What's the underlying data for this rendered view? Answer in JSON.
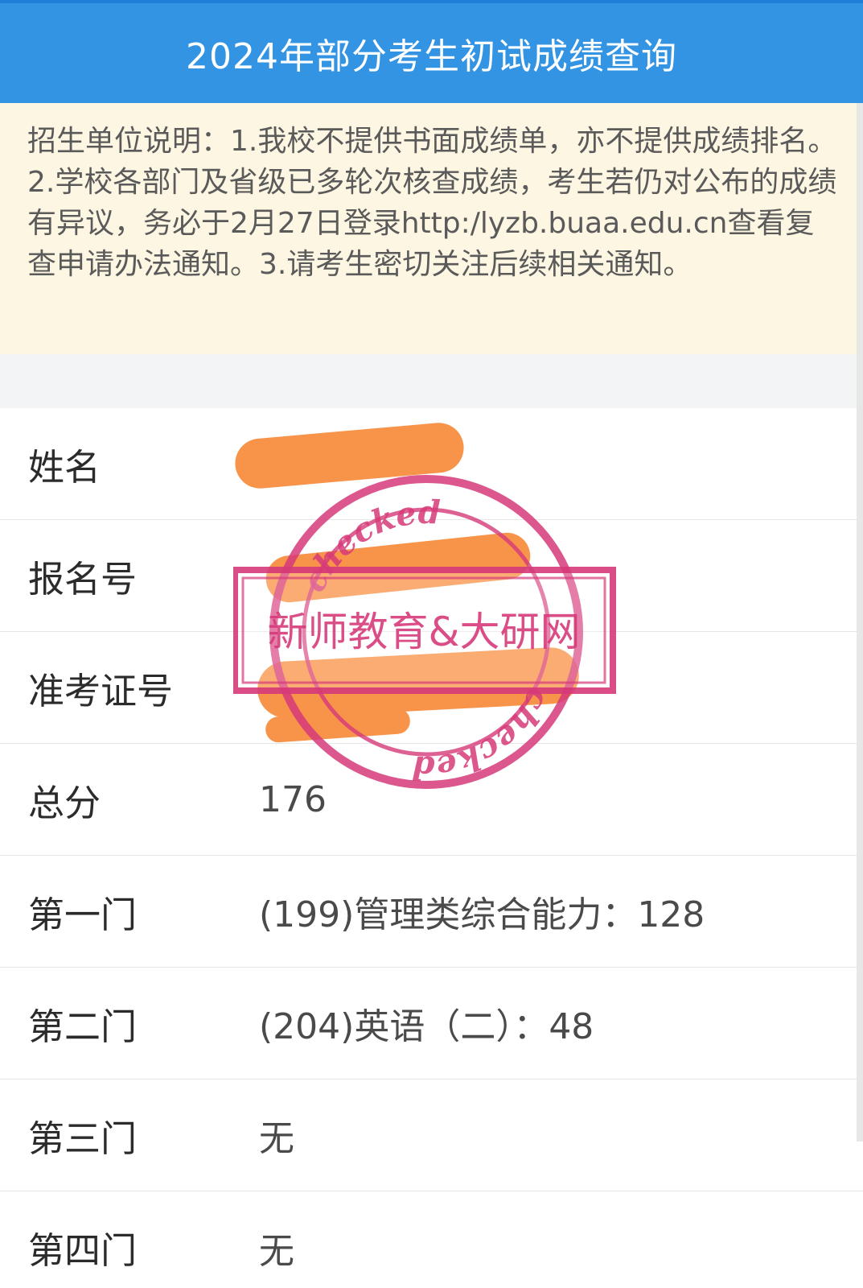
{
  "header": {
    "title": "2024年部分考生初试成绩查询"
  },
  "notice": {
    "text": "招生单位说明：1.我校不提供书面成绩单，亦不提供成绩排名。2.学校各部门及省级已多轮次核查成绩，考生若仍对公布的成绩有异议，务必于2月27日登录http:/lyzb.buaa.edu.cn查看复查申请办法通知。3.请考生密切关注后续相关通知。"
  },
  "rows": [
    {
      "label": "姓名",
      "value": ""
    },
    {
      "label": "报名号",
      "value": ""
    },
    {
      "label": "准考证号",
      "value": ""
    },
    {
      "label": "总分",
      "value": "176"
    },
    {
      "label": "第一门",
      "value": "(199)管理类综合能力：128"
    },
    {
      "label": "第二门",
      "value": "(204)英语（二）：48"
    },
    {
      "label": "第三门",
      "value": "无"
    },
    {
      "label": "第四门",
      "value": "无"
    }
  ],
  "stamp": {
    "ring_text": "checked",
    "banner_text": "新师教育&大研网"
  },
  "colors": {
    "header_bg": "#3394e3",
    "notice_bg": "#fdf6e3",
    "redaction": "#f8944a",
    "stamp": "#d63a79"
  }
}
